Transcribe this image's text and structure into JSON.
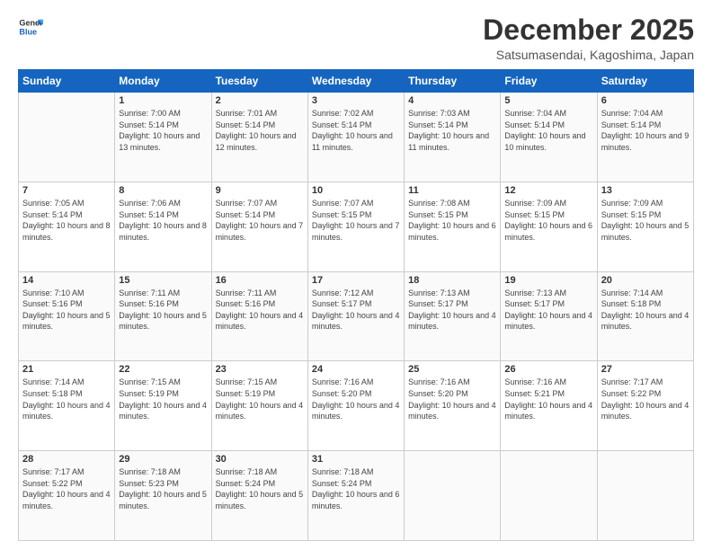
{
  "header": {
    "logo_line1": "General",
    "logo_line2": "Blue",
    "month_title": "December 2025",
    "location": "Satsumasendai, Kagoshima, Japan"
  },
  "days_of_week": [
    "Sunday",
    "Monday",
    "Tuesday",
    "Wednesday",
    "Thursday",
    "Friday",
    "Saturday"
  ],
  "weeks": [
    [
      {
        "day": "",
        "sunrise": "",
        "sunset": "",
        "daylight": ""
      },
      {
        "day": "1",
        "sunrise": "Sunrise: 7:00 AM",
        "sunset": "Sunset: 5:14 PM",
        "daylight": "Daylight: 10 hours and 13 minutes."
      },
      {
        "day": "2",
        "sunrise": "Sunrise: 7:01 AM",
        "sunset": "Sunset: 5:14 PM",
        "daylight": "Daylight: 10 hours and 12 minutes."
      },
      {
        "day": "3",
        "sunrise": "Sunrise: 7:02 AM",
        "sunset": "Sunset: 5:14 PM",
        "daylight": "Daylight: 10 hours and 11 minutes."
      },
      {
        "day": "4",
        "sunrise": "Sunrise: 7:03 AM",
        "sunset": "Sunset: 5:14 PM",
        "daylight": "Daylight: 10 hours and 11 minutes."
      },
      {
        "day": "5",
        "sunrise": "Sunrise: 7:04 AM",
        "sunset": "Sunset: 5:14 PM",
        "daylight": "Daylight: 10 hours and 10 minutes."
      },
      {
        "day": "6",
        "sunrise": "Sunrise: 7:04 AM",
        "sunset": "Sunset: 5:14 PM",
        "daylight": "Daylight: 10 hours and 9 minutes."
      }
    ],
    [
      {
        "day": "7",
        "sunrise": "Sunrise: 7:05 AM",
        "sunset": "Sunset: 5:14 PM",
        "daylight": "Daylight: 10 hours and 8 minutes."
      },
      {
        "day": "8",
        "sunrise": "Sunrise: 7:06 AM",
        "sunset": "Sunset: 5:14 PM",
        "daylight": "Daylight: 10 hours and 8 minutes."
      },
      {
        "day": "9",
        "sunrise": "Sunrise: 7:07 AM",
        "sunset": "Sunset: 5:14 PM",
        "daylight": "Daylight: 10 hours and 7 minutes."
      },
      {
        "day": "10",
        "sunrise": "Sunrise: 7:07 AM",
        "sunset": "Sunset: 5:15 PM",
        "daylight": "Daylight: 10 hours and 7 minutes."
      },
      {
        "day": "11",
        "sunrise": "Sunrise: 7:08 AM",
        "sunset": "Sunset: 5:15 PM",
        "daylight": "Daylight: 10 hours and 6 minutes."
      },
      {
        "day": "12",
        "sunrise": "Sunrise: 7:09 AM",
        "sunset": "Sunset: 5:15 PM",
        "daylight": "Daylight: 10 hours and 6 minutes."
      },
      {
        "day": "13",
        "sunrise": "Sunrise: 7:09 AM",
        "sunset": "Sunset: 5:15 PM",
        "daylight": "Daylight: 10 hours and 5 minutes."
      }
    ],
    [
      {
        "day": "14",
        "sunrise": "Sunrise: 7:10 AM",
        "sunset": "Sunset: 5:16 PM",
        "daylight": "Daylight: 10 hours and 5 minutes."
      },
      {
        "day": "15",
        "sunrise": "Sunrise: 7:11 AM",
        "sunset": "Sunset: 5:16 PM",
        "daylight": "Daylight: 10 hours and 5 minutes."
      },
      {
        "day": "16",
        "sunrise": "Sunrise: 7:11 AM",
        "sunset": "Sunset: 5:16 PM",
        "daylight": "Daylight: 10 hours and 4 minutes."
      },
      {
        "day": "17",
        "sunrise": "Sunrise: 7:12 AM",
        "sunset": "Sunset: 5:17 PM",
        "daylight": "Daylight: 10 hours and 4 minutes."
      },
      {
        "day": "18",
        "sunrise": "Sunrise: 7:13 AM",
        "sunset": "Sunset: 5:17 PM",
        "daylight": "Daylight: 10 hours and 4 minutes."
      },
      {
        "day": "19",
        "sunrise": "Sunrise: 7:13 AM",
        "sunset": "Sunset: 5:17 PM",
        "daylight": "Daylight: 10 hours and 4 minutes."
      },
      {
        "day": "20",
        "sunrise": "Sunrise: 7:14 AM",
        "sunset": "Sunset: 5:18 PM",
        "daylight": "Daylight: 10 hours and 4 minutes."
      }
    ],
    [
      {
        "day": "21",
        "sunrise": "Sunrise: 7:14 AM",
        "sunset": "Sunset: 5:18 PM",
        "daylight": "Daylight: 10 hours and 4 minutes."
      },
      {
        "day": "22",
        "sunrise": "Sunrise: 7:15 AM",
        "sunset": "Sunset: 5:19 PM",
        "daylight": "Daylight: 10 hours and 4 minutes."
      },
      {
        "day": "23",
        "sunrise": "Sunrise: 7:15 AM",
        "sunset": "Sunset: 5:19 PM",
        "daylight": "Daylight: 10 hours and 4 minutes."
      },
      {
        "day": "24",
        "sunrise": "Sunrise: 7:16 AM",
        "sunset": "Sunset: 5:20 PM",
        "daylight": "Daylight: 10 hours and 4 minutes."
      },
      {
        "day": "25",
        "sunrise": "Sunrise: 7:16 AM",
        "sunset": "Sunset: 5:20 PM",
        "daylight": "Daylight: 10 hours and 4 minutes."
      },
      {
        "day": "26",
        "sunrise": "Sunrise: 7:16 AM",
        "sunset": "Sunset: 5:21 PM",
        "daylight": "Daylight: 10 hours and 4 minutes."
      },
      {
        "day": "27",
        "sunrise": "Sunrise: 7:17 AM",
        "sunset": "Sunset: 5:22 PM",
        "daylight": "Daylight: 10 hours and 4 minutes."
      }
    ],
    [
      {
        "day": "28",
        "sunrise": "Sunrise: 7:17 AM",
        "sunset": "Sunset: 5:22 PM",
        "daylight": "Daylight: 10 hours and 4 minutes."
      },
      {
        "day": "29",
        "sunrise": "Sunrise: 7:18 AM",
        "sunset": "Sunset: 5:23 PM",
        "daylight": "Daylight: 10 hours and 5 minutes."
      },
      {
        "day": "30",
        "sunrise": "Sunrise: 7:18 AM",
        "sunset": "Sunset: 5:24 PM",
        "daylight": "Daylight: 10 hours and 5 minutes."
      },
      {
        "day": "31",
        "sunrise": "Sunrise: 7:18 AM",
        "sunset": "Sunset: 5:24 PM",
        "daylight": "Daylight: 10 hours and 6 minutes."
      },
      {
        "day": "",
        "sunrise": "",
        "sunset": "",
        "daylight": ""
      },
      {
        "day": "",
        "sunrise": "",
        "sunset": "",
        "daylight": ""
      },
      {
        "day": "",
        "sunrise": "",
        "sunset": "",
        "daylight": ""
      }
    ]
  ]
}
